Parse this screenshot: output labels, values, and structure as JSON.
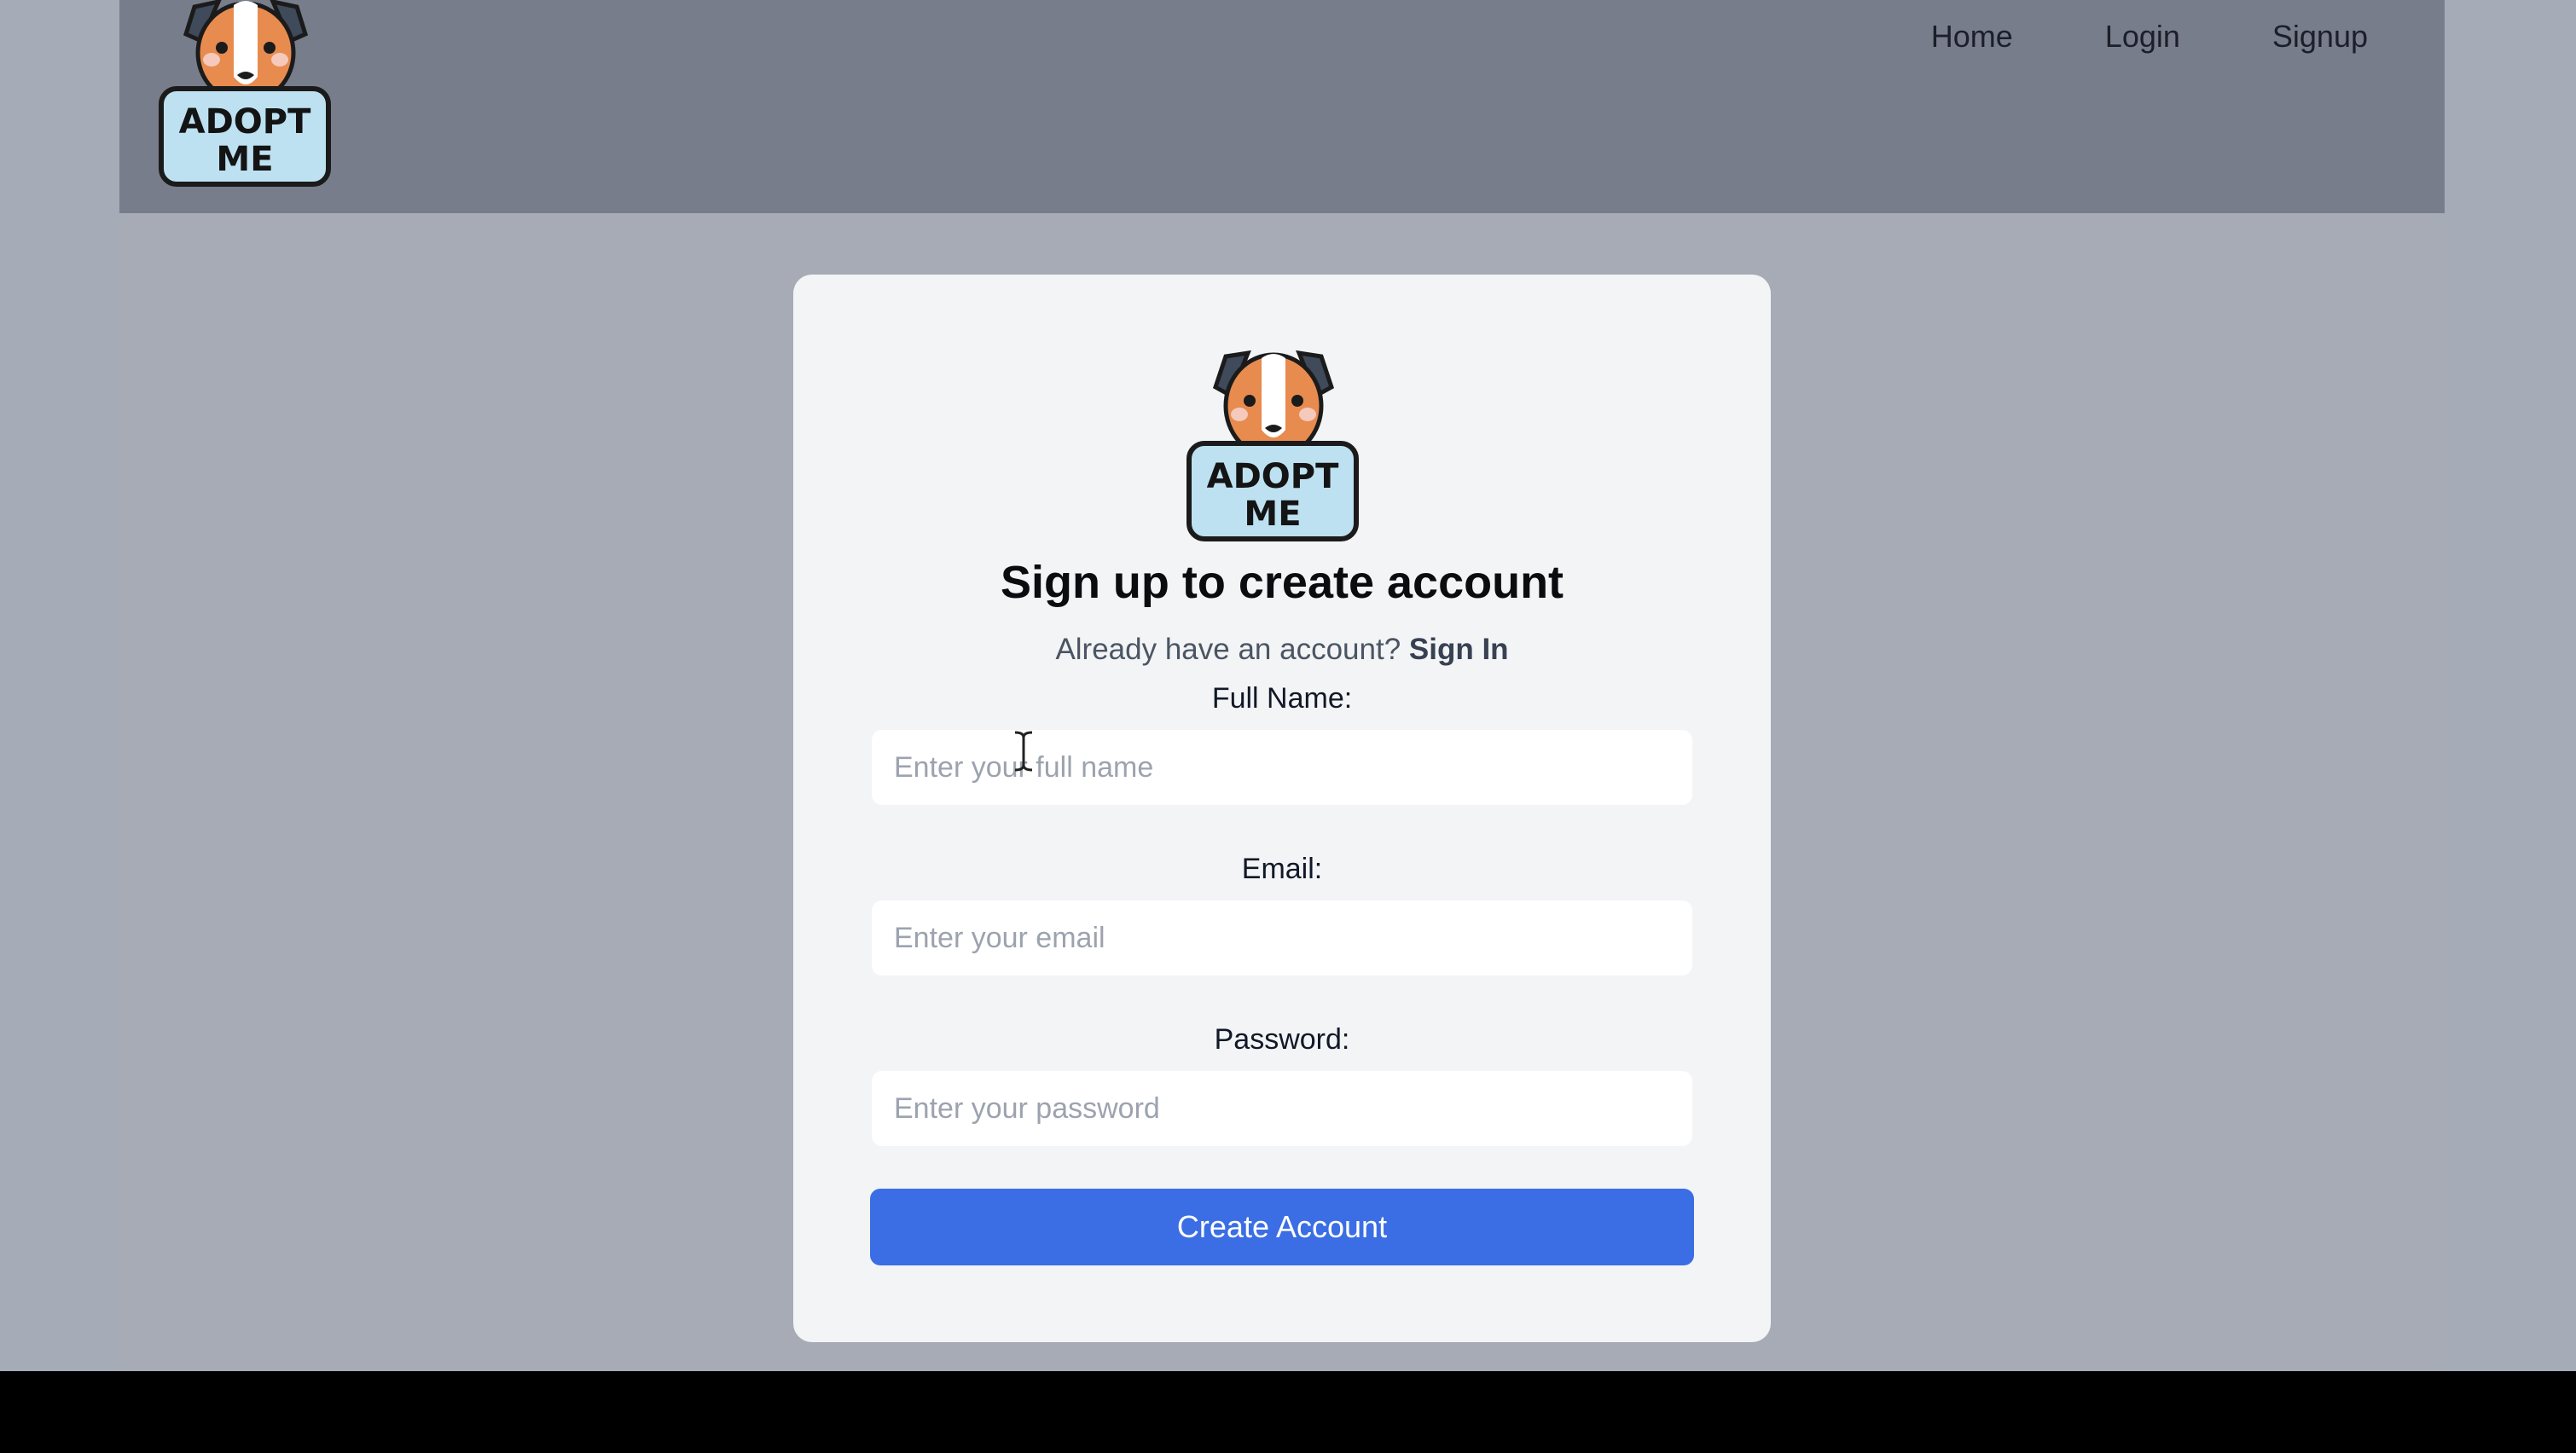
{
  "nav": {
    "logo_text_line1": "ADOPT",
    "logo_text_line2": "ME",
    "links": [
      "Home",
      "Login",
      "Signup"
    ]
  },
  "card": {
    "logo_text_line1": "ADOPT",
    "logo_text_line2": "ME",
    "title": "Sign up to create account",
    "subtitle_prefix": "Already have an account?",
    "signin_label": "Sign In",
    "fields": {
      "full_name": {
        "label": "Full Name:",
        "placeholder": "Enter your full name"
      },
      "email": {
        "label": "Email:",
        "placeholder": "Enter your email"
      },
      "password": {
        "label": "Password:",
        "placeholder": "Enter your password"
      }
    },
    "submit_label": "Create Account"
  },
  "colors": {
    "navbar": "#787d8b",
    "page_background": "#a6abb5",
    "card_background": "#f3f4f6",
    "primary_button": "#3b6ee4"
  },
  "icons": [
    "dog-mascot-logo-icon",
    "text-cursor-icon"
  ]
}
